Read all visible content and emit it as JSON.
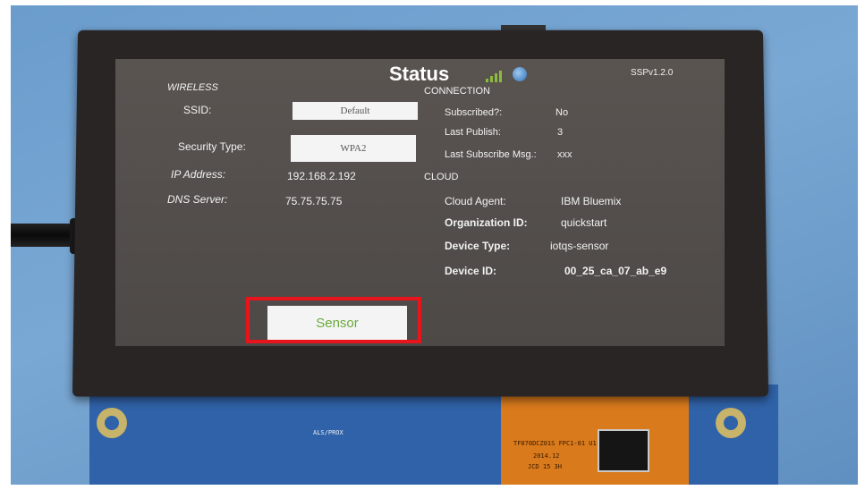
{
  "screen": {
    "title": "Status",
    "version": "SSPv1.2.0",
    "wireless": {
      "heading": "WIRELESS",
      "ssid_label": "SSID:",
      "ssid_value": "Default",
      "security_label": "Security Type:",
      "security_value": "WPA2",
      "ip_label": "IP Address:",
      "ip_value": "192.168.2.192",
      "dns_label": "DNS Server:",
      "dns_value": "75.75.75.75"
    },
    "connection": {
      "heading": "CONNECTION",
      "subscribed_label": "Subscribed?:",
      "subscribed_value": "No",
      "last_publish_label": "Last Publish:",
      "last_publish_value": "3",
      "last_sub_label": "Last Subscribe Msg.:",
      "last_sub_value": "xxx"
    },
    "cloud": {
      "heading": "CLOUD",
      "agent_label": "Cloud Agent:",
      "agent_value": "IBM Bluemix",
      "org_label": "Organization ID:",
      "org_value": "quickstart",
      "type_label": "Device Type:",
      "type_value": "iotqs-sensor",
      "id_label": "Device ID:",
      "id_value": "00_25_ca_07_ab_e9"
    },
    "sensor_button_label": "Sensor",
    "icons": [
      "signal-strength-icon",
      "globe-icon"
    ]
  },
  "board": {
    "silkscreen_label": "ALS/PROX",
    "flex_text_1": "TF070DCZ01S FPC1-01  U1-01",
    "flex_text_2": "2014.12",
    "flex_text_3": "JCD 15 3H"
  },
  "colors": {
    "highlight": "#e8141c",
    "sensor_text": "#6aaa3a",
    "signal": "#8dbb3f"
  }
}
